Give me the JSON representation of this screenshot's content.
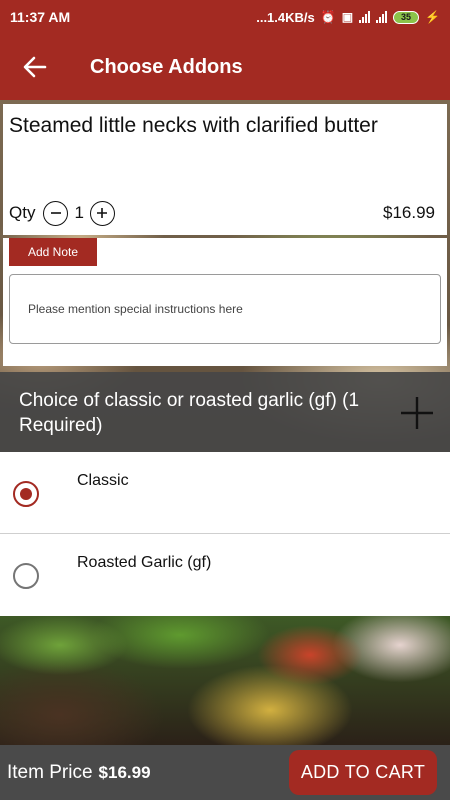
{
  "status_bar": {
    "time": "11:37 AM",
    "network_speed": "...1.4KB/s",
    "battery": "35"
  },
  "app_bar": {
    "title": "Choose Addons"
  },
  "item": {
    "name": "Steamed little necks with clarified butter",
    "qty_label": "Qty",
    "qty_value": "1",
    "price": "$16.99"
  },
  "note": {
    "button_label": "Add Note",
    "placeholder": "Please mention special instructions here"
  },
  "addon_group": {
    "title": "Choice of classic or roasted garlic (gf) (1 Required)",
    "options": [
      {
        "label": "Classic",
        "selected": true
      },
      {
        "label": "Roasted Garlic (gf)",
        "selected": false
      }
    ]
  },
  "bottom_bar": {
    "item_price_label": "Item Price",
    "item_price_value": "$16.99",
    "add_to_cart_label": "ADD TO CART"
  },
  "colors": {
    "brand": "#a32a22",
    "bottom_bar": "#4a4a4a"
  }
}
